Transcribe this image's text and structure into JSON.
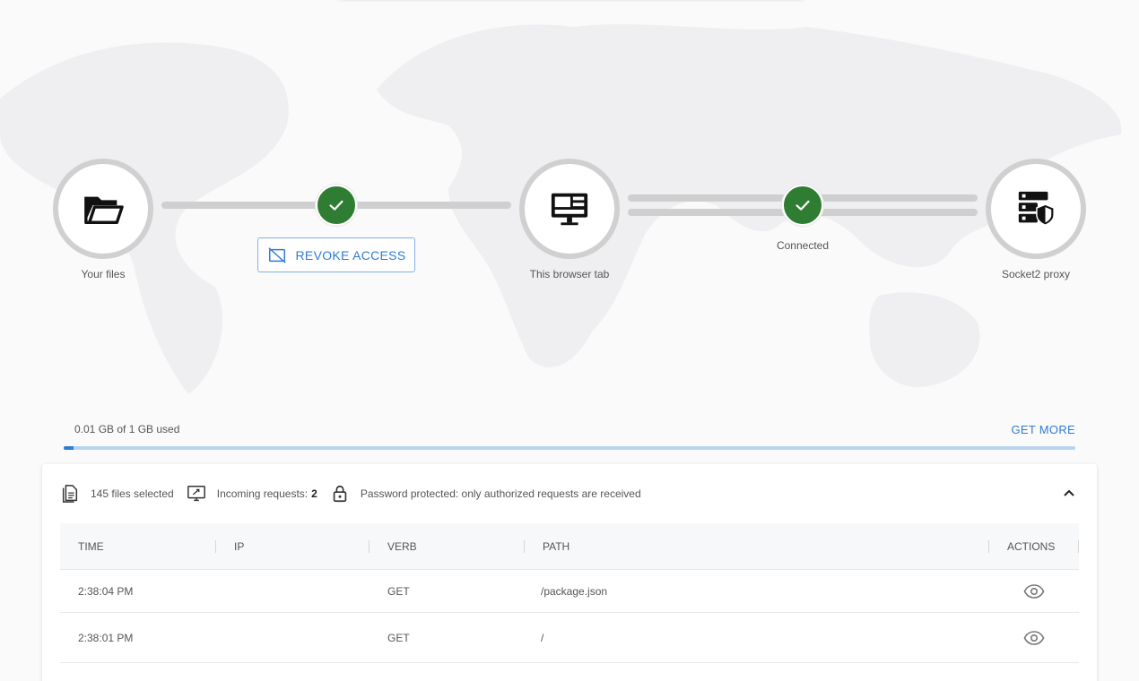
{
  "flow": {
    "your_files_label": "Your files",
    "revoke_label": "REVOKE ACCESS",
    "browser_tab_label": "This browser tab",
    "connected_label": "Connected",
    "proxy_label": "Socket2 proxy"
  },
  "storage": {
    "usage_text": "0.01 GB of 1 GB used",
    "get_more_label": "GET MORE",
    "used_fraction": 0.01
  },
  "info": {
    "files_selected": "145 files selected",
    "incoming_label": "Incoming requests:",
    "incoming_count": "2",
    "password_text": "Password protected: only authorized requests are received"
  },
  "table": {
    "headers": {
      "time": "TIME",
      "ip": "IP",
      "verb": "VERB",
      "path": "PATH",
      "actions": "ACTIONS"
    },
    "rows": [
      {
        "time": "2:38:04 PM",
        "ip": "",
        "verb": "GET",
        "path": "/package.json"
      },
      {
        "time": "2:38:01 PM",
        "ip": "",
        "verb": "GET",
        "path": "/"
      }
    ]
  },
  "colors": {
    "accent": "#2f7cd6",
    "success": "#2e7d32",
    "track": "#cfcfcf"
  },
  "icons": [
    "folder-open-icon",
    "check-icon",
    "revoke-icon",
    "monitor-icon",
    "server-shield-icon",
    "files-icon",
    "incoming-requests-icon",
    "lock-icon",
    "chevron-up-icon",
    "eye-icon"
  ]
}
